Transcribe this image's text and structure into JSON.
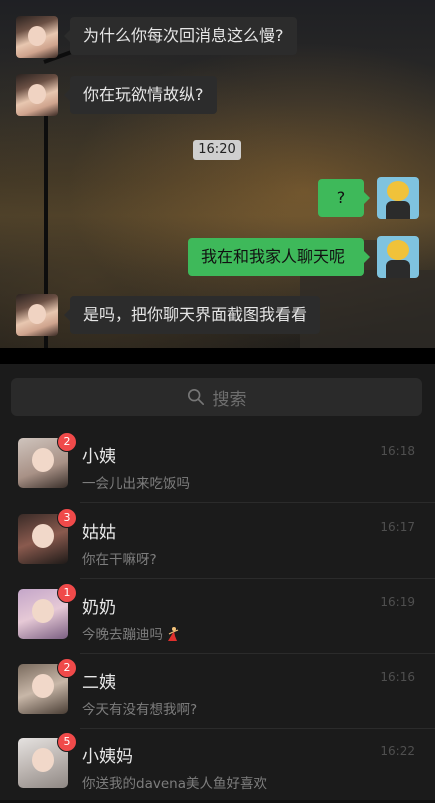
{
  "chat": {
    "messages": [
      {
        "side": "in",
        "text": "为什么你每次回消息这么慢?"
      },
      {
        "side": "in",
        "text": "你在玩欲情故纵?"
      },
      {
        "side": "time",
        "text": "16:20"
      },
      {
        "side": "out",
        "text": "?"
      },
      {
        "side": "out",
        "text": "我在和我家人聊天呢"
      },
      {
        "side": "in",
        "text": "是吗，把你聊天界面截图我看看"
      }
    ]
  },
  "search": {
    "placeholder": "搜索"
  },
  "conversations": [
    {
      "name": "小姨",
      "message": "一会儿出来吃饭吗",
      "time": "16:18",
      "unread": "2"
    },
    {
      "name": "姑姑",
      "message": "你在干嘛呀?",
      "time": "16:17",
      "unread": "3"
    },
    {
      "name": "奶奶",
      "message": "今晚去蹦迪吗",
      "time": "16:19",
      "unread": "1",
      "emoji": "dancer-icon"
    },
    {
      "name": "二姨",
      "message": "今天有没有想我啊?",
      "time": "16:16",
      "unread": "2"
    },
    {
      "name": "小姨妈",
      "message": "你送我的davena美人鱼好喜欢",
      "time": "16:22",
      "unread": "5"
    }
  ],
  "colors": {
    "outgoing_bubble": "#3eb95a",
    "incoming_bubble": "#2c2c2c",
    "badge": "#f04a4a"
  }
}
